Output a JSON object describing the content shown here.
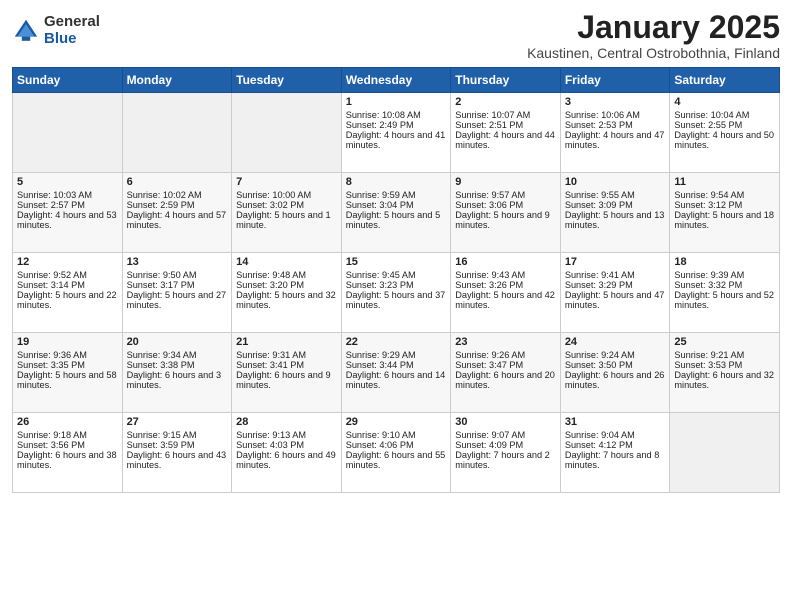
{
  "header": {
    "logo_general": "General",
    "logo_blue": "Blue",
    "month_year": "January 2025",
    "location": "Kaustinen, Central Ostrobothnia, Finland"
  },
  "days_of_week": [
    "Sunday",
    "Monday",
    "Tuesday",
    "Wednesday",
    "Thursday",
    "Friday",
    "Saturday"
  ],
  "weeks": [
    [
      {
        "day": "",
        "sunrise": "",
        "sunset": "",
        "daylight": ""
      },
      {
        "day": "",
        "sunrise": "",
        "sunset": "",
        "daylight": ""
      },
      {
        "day": "",
        "sunrise": "",
        "sunset": "",
        "daylight": ""
      },
      {
        "day": "1",
        "sunrise": "Sunrise: 10:08 AM",
        "sunset": "Sunset: 2:49 PM",
        "daylight": "Daylight: 4 hours and 41 minutes."
      },
      {
        "day": "2",
        "sunrise": "Sunrise: 10:07 AM",
        "sunset": "Sunset: 2:51 PM",
        "daylight": "Daylight: 4 hours and 44 minutes."
      },
      {
        "day": "3",
        "sunrise": "Sunrise: 10:06 AM",
        "sunset": "Sunset: 2:53 PM",
        "daylight": "Daylight: 4 hours and 47 minutes."
      },
      {
        "day": "4",
        "sunrise": "Sunrise: 10:04 AM",
        "sunset": "Sunset: 2:55 PM",
        "daylight": "Daylight: 4 hours and 50 minutes."
      }
    ],
    [
      {
        "day": "5",
        "sunrise": "Sunrise: 10:03 AM",
        "sunset": "Sunset: 2:57 PM",
        "daylight": "Daylight: 4 hours and 53 minutes."
      },
      {
        "day": "6",
        "sunrise": "Sunrise: 10:02 AM",
        "sunset": "Sunset: 2:59 PM",
        "daylight": "Daylight: 4 hours and 57 minutes."
      },
      {
        "day": "7",
        "sunrise": "Sunrise: 10:00 AM",
        "sunset": "Sunset: 3:02 PM",
        "daylight": "Daylight: 5 hours and 1 minute."
      },
      {
        "day": "8",
        "sunrise": "Sunrise: 9:59 AM",
        "sunset": "Sunset: 3:04 PM",
        "daylight": "Daylight: 5 hours and 5 minutes."
      },
      {
        "day": "9",
        "sunrise": "Sunrise: 9:57 AM",
        "sunset": "Sunset: 3:06 PM",
        "daylight": "Daylight: 5 hours and 9 minutes."
      },
      {
        "day": "10",
        "sunrise": "Sunrise: 9:55 AM",
        "sunset": "Sunset: 3:09 PM",
        "daylight": "Daylight: 5 hours and 13 minutes."
      },
      {
        "day": "11",
        "sunrise": "Sunrise: 9:54 AM",
        "sunset": "Sunset: 3:12 PM",
        "daylight": "Daylight: 5 hours and 18 minutes."
      }
    ],
    [
      {
        "day": "12",
        "sunrise": "Sunrise: 9:52 AM",
        "sunset": "Sunset: 3:14 PM",
        "daylight": "Daylight: 5 hours and 22 minutes."
      },
      {
        "day": "13",
        "sunrise": "Sunrise: 9:50 AM",
        "sunset": "Sunset: 3:17 PM",
        "daylight": "Daylight: 5 hours and 27 minutes."
      },
      {
        "day": "14",
        "sunrise": "Sunrise: 9:48 AM",
        "sunset": "Sunset: 3:20 PM",
        "daylight": "Daylight: 5 hours and 32 minutes."
      },
      {
        "day": "15",
        "sunrise": "Sunrise: 9:45 AM",
        "sunset": "Sunset: 3:23 PM",
        "daylight": "Daylight: 5 hours and 37 minutes."
      },
      {
        "day": "16",
        "sunrise": "Sunrise: 9:43 AM",
        "sunset": "Sunset: 3:26 PM",
        "daylight": "Daylight: 5 hours and 42 minutes."
      },
      {
        "day": "17",
        "sunrise": "Sunrise: 9:41 AM",
        "sunset": "Sunset: 3:29 PM",
        "daylight": "Daylight: 5 hours and 47 minutes."
      },
      {
        "day": "18",
        "sunrise": "Sunrise: 9:39 AM",
        "sunset": "Sunset: 3:32 PM",
        "daylight": "Daylight: 5 hours and 52 minutes."
      }
    ],
    [
      {
        "day": "19",
        "sunrise": "Sunrise: 9:36 AM",
        "sunset": "Sunset: 3:35 PM",
        "daylight": "Daylight: 5 hours and 58 minutes."
      },
      {
        "day": "20",
        "sunrise": "Sunrise: 9:34 AM",
        "sunset": "Sunset: 3:38 PM",
        "daylight": "Daylight: 6 hours and 3 minutes."
      },
      {
        "day": "21",
        "sunrise": "Sunrise: 9:31 AM",
        "sunset": "Sunset: 3:41 PM",
        "daylight": "Daylight: 6 hours and 9 minutes."
      },
      {
        "day": "22",
        "sunrise": "Sunrise: 9:29 AM",
        "sunset": "Sunset: 3:44 PM",
        "daylight": "Daylight: 6 hours and 14 minutes."
      },
      {
        "day": "23",
        "sunrise": "Sunrise: 9:26 AM",
        "sunset": "Sunset: 3:47 PM",
        "daylight": "Daylight: 6 hours and 20 minutes."
      },
      {
        "day": "24",
        "sunrise": "Sunrise: 9:24 AM",
        "sunset": "Sunset: 3:50 PM",
        "daylight": "Daylight: 6 hours and 26 minutes."
      },
      {
        "day": "25",
        "sunrise": "Sunrise: 9:21 AM",
        "sunset": "Sunset: 3:53 PM",
        "daylight": "Daylight: 6 hours and 32 minutes."
      }
    ],
    [
      {
        "day": "26",
        "sunrise": "Sunrise: 9:18 AM",
        "sunset": "Sunset: 3:56 PM",
        "daylight": "Daylight: 6 hours and 38 minutes."
      },
      {
        "day": "27",
        "sunrise": "Sunrise: 9:15 AM",
        "sunset": "Sunset: 3:59 PM",
        "daylight": "Daylight: 6 hours and 43 minutes."
      },
      {
        "day": "28",
        "sunrise": "Sunrise: 9:13 AM",
        "sunset": "Sunset: 4:03 PM",
        "daylight": "Daylight: 6 hours and 49 minutes."
      },
      {
        "day": "29",
        "sunrise": "Sunrise: 9:10 AM",
        "sunset": "Sunset: 4:06 PM",
        "daylight": "Daylight: 6 hours and 55 minutes."
      },
      {
        "day": "30",
        "sunrise": "Sunrise: 9:07 AM",
        "sunset": "Sunset: 4:09 PM",
        "daylight": "Daylight: 7 hours and 2 minutes."
      },
      {
        "day": "31",
        "sunrise": "Sunrise: 9:04 AM",
        "sunset": "Sunset: 4:12 PM",
        "daylight": "Daylight: 7 hours and 8 minutes."
      },
      {
        "day": "",
        "sunrise": "",
        "sunset": "",
        "daylight": ""
      }
    ]
  ]
}
